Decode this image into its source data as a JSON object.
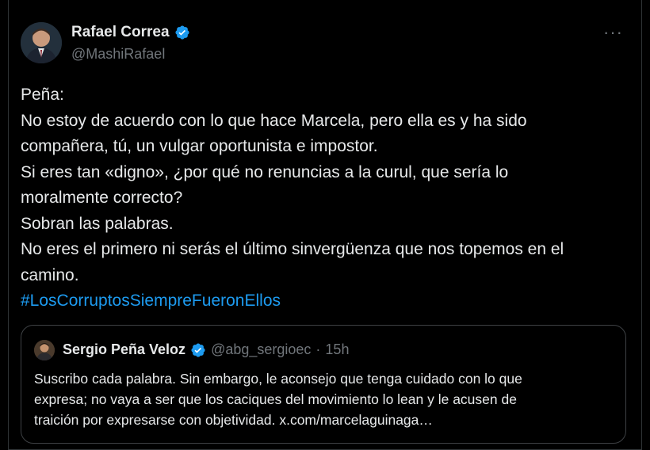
{
  "tweet": {
    "author_name": "Rafael Correa",
    "author_handle": "@MashiRafael",
    "more_label": "···",
    "lines": [
      "Peña:",
      "No estoy de acuerdo con lo que hace Marcela, pero ella es y ha sido",
      "compañera, tú, un vulgar oportunista e impostor.",
      "Si eres tan «digno», ¿por qué no renuncias a la curul, que sería lo",
      "moralmente correcto?",
      "Sobran las palabras.",
      "No eres el primero ni serás el último sinvergüenza que nos topemos en el",
      "camino."
    ],
    "hashtag": "#LosCorruptosSiempreFueronEllos"
  },
  "quote": {
    "author_name": "Sergio Peña Veloz",
    "author_handle": "@abg_sergioec",
    "separator": "·",
    "time": "15h",
    "lines": [
      "Suscribo cada palabra. Sin embargo, le aconsejo que tenga cuidado con lo que",
      "expresa; no vaya a ser que los caciques del movimiento lo lean y le acusen de",
      "traición por expresarse con objetividad. x.com/marcelaguinaga…"
    ]
  },
  "colors": {
    "background": "#000000",
    "text": "#e7e9ea",
    "muted": "#71767b",
    "accent": "#1d9bf0"
  },
  "icons": {
    "verified": "verified-badge-icon",
    "more": "more-options-icon"
  }
}
